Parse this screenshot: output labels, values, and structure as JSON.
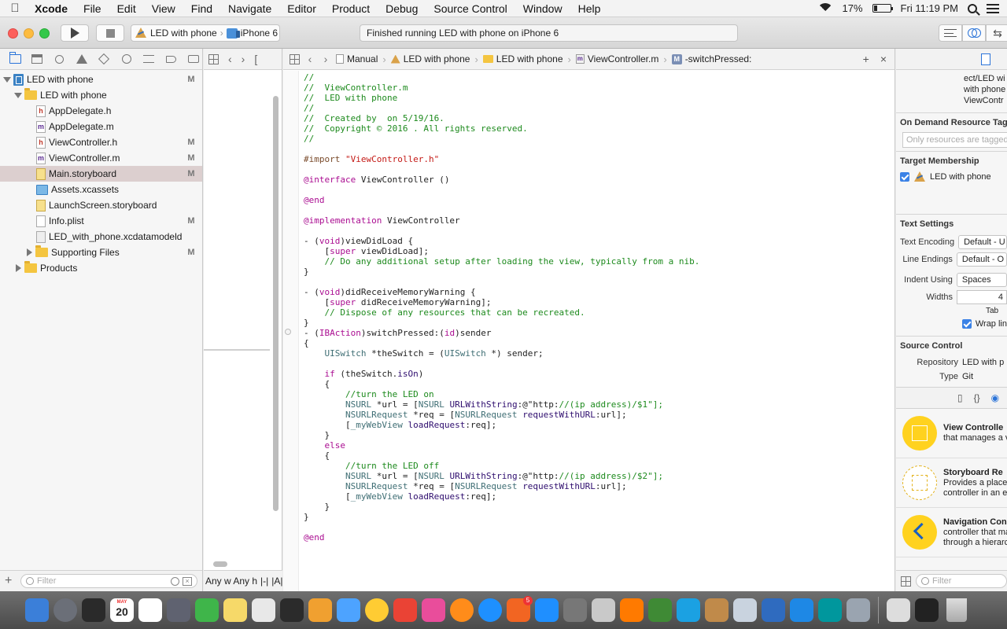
{
  "menubar": {
    "app": "Xcode",
    "items": [
      "File",
      "Edit",
      "View",
      "Find",
      "Navigate",
      "Editor",
      "Product",
      "Debug",
      "Source Control",
      "Window",
      "Help"
    ],
    "battery": "17%",
    "clock": "Fri 11:19 PM"
  },
  "toolbar": {
    "scheme": "LED with phone",
    "device": "iPhone 6",
    "activity": "Finished running LED with phone on iPhone 6"
  },
  "navigator": {
    "items": [
      {
        "label": "LED with phone",
        "badge": "M"
      },
      {
        "label": "LED with phone",
        "badge": ""
      },
      {
        "label": "AppDelegate.h",
        "badge": ""
      },
      {
        "label": "AppDelegate.m",
        "badge": ""
      },
      {
        "label": "ViewController.h",
        "badge": "M"
      },
      {
        "label": "ViewController.m",
        "badge": "M"
      },
      {
        "label": "Main.storyboard",
        "badge": "M"
      },
      {
        "label": "Assets.xcassets",
        "badge": ""
      },
      {
        "label": "LaunchScreen.storyboard",
        "badge": ""
      },
      {
        "label": "Info.plist",
        "badge": "M"
      },
      {
        "label": "LED_with_phone.xcdatamodeld",
        "badge": ""
      },
      {
        "label": "Supporting Files",
        "badge": "M"
      },
      {
        "label": "Products",
        "badge": ""
      }
    ],
    "filter_placeholder": "Filter"
  },
  "storyboard_pane": {
    "bottom_label": "Any w  Any h"
  },
  "editor": {
    "jumpbar": {
      "crumbs": [
        "Manual",
        "LED with phone",
        "LED with phone",
        "ViewController.m",
        "-switchPressed:"
      ],
      "method_badge": "M"
    },
    "code_lines": [
      "//",
      "//  ViewController.m",
      "//  LED with phone",
      "//",
      "//  Created by  on 5/19/16.",
      "//  Copyright © 2016 . All rights reserved.",
      "//",
      "",
      "#import \"ViewController.h\"",
      "",
      "@interface ViewController ()",
      "",
      "@end",
      "",
      "@implementation ViewController",
      "",
      "- (void)viewDidLoad {",
      "    [super viewDidLoad];",
      "    // Do any additional setup after loading the view, typically from a nib.",
      "}",
      "",
      "- (void)didReceiveMemoryWarning {",
      "    [super didReceiveMemoryWarning];",
      "    // Dispose of any resources that can be recreated.",
      "}",
      "- (IBAction)switchPressed:(id)sender",
      "{",
      "    UISwitch *theSwitch = (UISwitch *) sender;",
      "",
      "    if (theSwitch.isOn)",
      "    {",
      "        //turn the LED on",
      "        NSURL *url = [NSURL URLWithString:@\"http://(ip address)/$1\"];",
      "        NSURLRequest *req = [NSURLRequest requestWithURL:url];",
      "        [_myWebView loadRequest:req];",
      "    }",
      "    else",
      "    {",
      "        //turn the LED off",
      "        NSURL *url = [NSURL URLWithString:@\"http://(ip address)/$2\"];",
      "        NSURLRequest *req = [NSURLRequest requestWithURL:url];",
      "        [_myWebView loadRequest:req];",
      "    }",
      "}",
      "",
      "@end"
    ]
  },
  "inspector": {
    "path_lines": [
      "ect/LED wi",
      "with phone",
      "ViewContr"
    ],
    "odr_title": "On Demand Resource Tags",
    "odr_placeholder": "Only resources are tagged",
    "target_title": "Target Membership",
    "target_item": "LED with phone",
    "text_title": "Text Settings",
    "encoding_label": "Text Encoding",
    "encoding_value": "Default - U",
    "endings_label": "Line Endings",
    "endings_value": "Default - O",
    "indent_label": "Indent Using",
    "indent_value": "Spaces",
    "widths_label": "Widths",
    "widths_value": "4",
    "tab_label": "Tab",
    "wrap_label": "Wrap lin",
    "sc_title": "Source Control",
    "repo_label": "Repository",
    "repo_value": "LED with p",
    "type_label": "Type",
    "type_value": "Git",
    "library": [
      {
        "title": "View Controlle",
        "desc": [
          "that manages a v"
        ]
      },
      {
        "title": "Storyboard Re",
        "desc": [
          "Provides a placel",
          "controller in an ex"
        ]
      },
      {
        "title": "Navigation Con",
        "desc": [
          "controller that ma",
          "through a hierarc"
        ]
      }
    ],
    "filter_placeholder": "Filter"
  },
  "dock": {
    "calendar_month": "MAY",
    "calendar_day": "20",
    "appstore_badge": "5",
    "colors": [
      "#3b7fd9",
      "#6b6f78",
      "#2a2a2a",
      "#ffffff",
      "#ffffff",
      "#5f6270",
      "#3fb54a",
      "#f6d969",
      "#e8e8e8",
      "#2b2b2b",
      "#f0a030",
      "#4da3ff",
      "#ffcc33",
      "#ea4335",
      "#e94d9b",
      "#ff8c1a",
      "#1e90ff",
      "#f26522",
      "#1f8fff",
      "#777777",
      "#c9c9c9",
      "#ff7a00",
      "#3f8a35",
      "#1ba1e2",
      "#c08a4a",
      "#c9d3df",
      "#2f6bbf",
      "#1e88e5",
      "#00979d",
      "#9aa4b0",
      "#dddddd",
      "#222222",
      "#ffffff"
    ]
  }
}
